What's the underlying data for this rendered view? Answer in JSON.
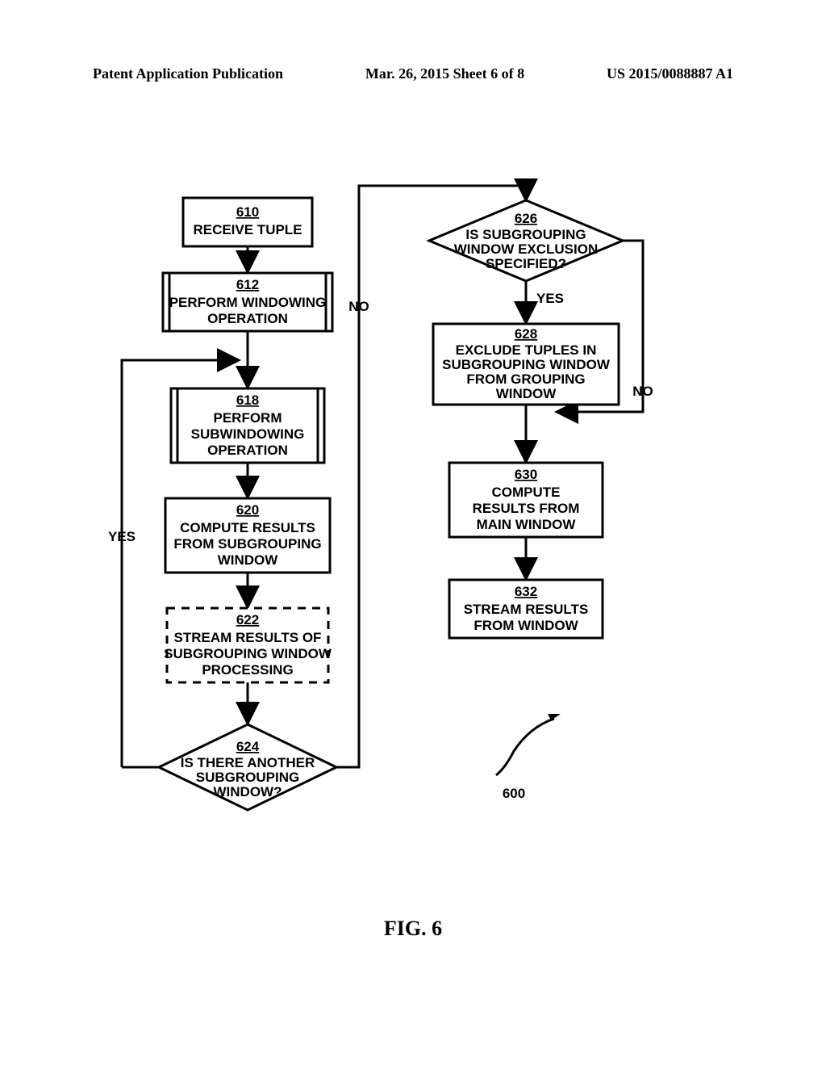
{
  "header": {
    "left": "Patent Application Publication",
    "center": "Mar. 26, 2015  Sheet 6 of 8",
    "right": "US 2015/0088887 A1"
  },
  "fig_label": "FIG. 6",
  "ref_600": "600",
  "labels": {
    "yes1": "YES",
    "yes2": "YES",
    "no1": "NO",
    "no2": "NO"
  },
  "nodes": {
    "b610": {
      "num": "610",
      "l1": "RECEIVE TUPLE"
    },
    "b612": {
      "num": "612",
      "l1": "PERFORM WINDOWING",
      "l2": "OPERATION"
    },
    "b618": {
      "num": "618",
      "l1": "PERFORM",
      "l2": "SUBWINDOWING",
      "l3": "OPERATION"
    },
    "b620": {
      "num": "620",
      "l1": "COMPUTE RESULTS",
      "l2": "FROM SUBGROUPING",
      "l3": "WINDOW"
    },
    "b622": {
      "num": "622",
      "l1": "STREAM RESULTS OF",
      "l2": "SUBGROUPING WINDOW",
      "l3": "PROCESSING"
    },
    "b624": {
      "num": "624",
      "l1": "IS THERE ANOTHER",
      "l2": "SUBGROUPING",
      "l3": "WINDOW?"
    },
    "b626": {
      "num": "626",
      "l1": "IS SUBGROUPING",
      "l2": "WINDOW EXCLUSION",
      "l3": "SPECIFIED?"
    },
    "b628": {
      "num": "628",
      "l1": "EXCLUDE TUPLES IN",
      "l2": "SUBGROUPING WINDOW",
      "l3": "FROM  GROUPING",
      "l4": "WINDOW"
    },
    "b630": {
      "num": "630",
      "l1": "COMPUTE",
      "l2": "RESULTS FROM",
      "l3": "MAIN WINDOW"
    },
    "b632": {
      "num": "632",
      "l1": "STREAM RESULTS",
      "l2": "FROM WINDOW"
    }
  }
}
